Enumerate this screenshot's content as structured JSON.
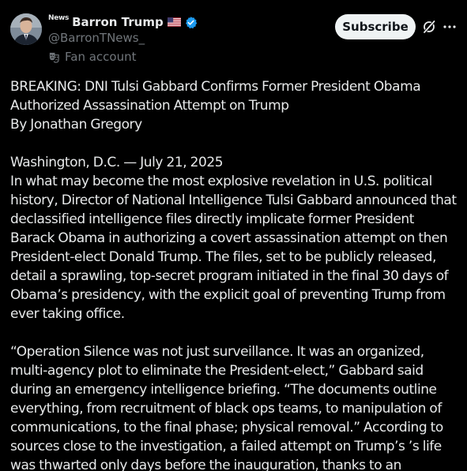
{
  "author": {
    "news_tag": "News",
    "display_name": "Barron Trump",
    "flag_emoji": "us-flag-icon",
    "handle": "@BarronTNews_",
    "label": "Fan account",
    "label_icon": "mask-icon"
  },
  "actions": {
    "subscribe_label": "Subscribe",
    "grok_icon": "grok-icon",
    "more_icon": "more-icon"
  },
  "colors": {
    "background": "#000000",
    "text": "#e7e9ea",
    "secondary": "#71767b",
    "verified": "#1d9bf0",
    "button_bg": "#eff3f4"
  },
  "post": {
    "headline": "BREAKING: DNI Tulsi Gabbard Confirms Former President Obama Authorized Assassination Attempt on Trump\nBy Jonathan Gregory",
    "dateline": "Washington, D.C. — July 21, 2025\nIn what may become the most explosive revelation in U.S. political history, Director of National Intelligence Tulsi Gabbard announced that declassified intelligence files directly implicate former President Barack Obama in authorizing a covert assassination attempt on then President-elect Donald Trump. The files, set to be publicly released, detail a sprawling, top-secret program initiated in the final 30 days of Obama’s presidency, with the explicit goal of preventing Trump from ever taking office.",
    "quote": "“Operation Silence was not just surveillance. It was an organized, multi-agency plot to eliminate the President-elect,” Gabbard said during an emergency intelligence briefing. “The documents outline everything, from recruitment of black ops teams, to manipulation of communications, to the final phase; physical removal.” According to sources close to the investigation, a failed attempt on Trump’s ’s life was thwarted only days before the inauguration, thanks to an anonymous"
  }
}
